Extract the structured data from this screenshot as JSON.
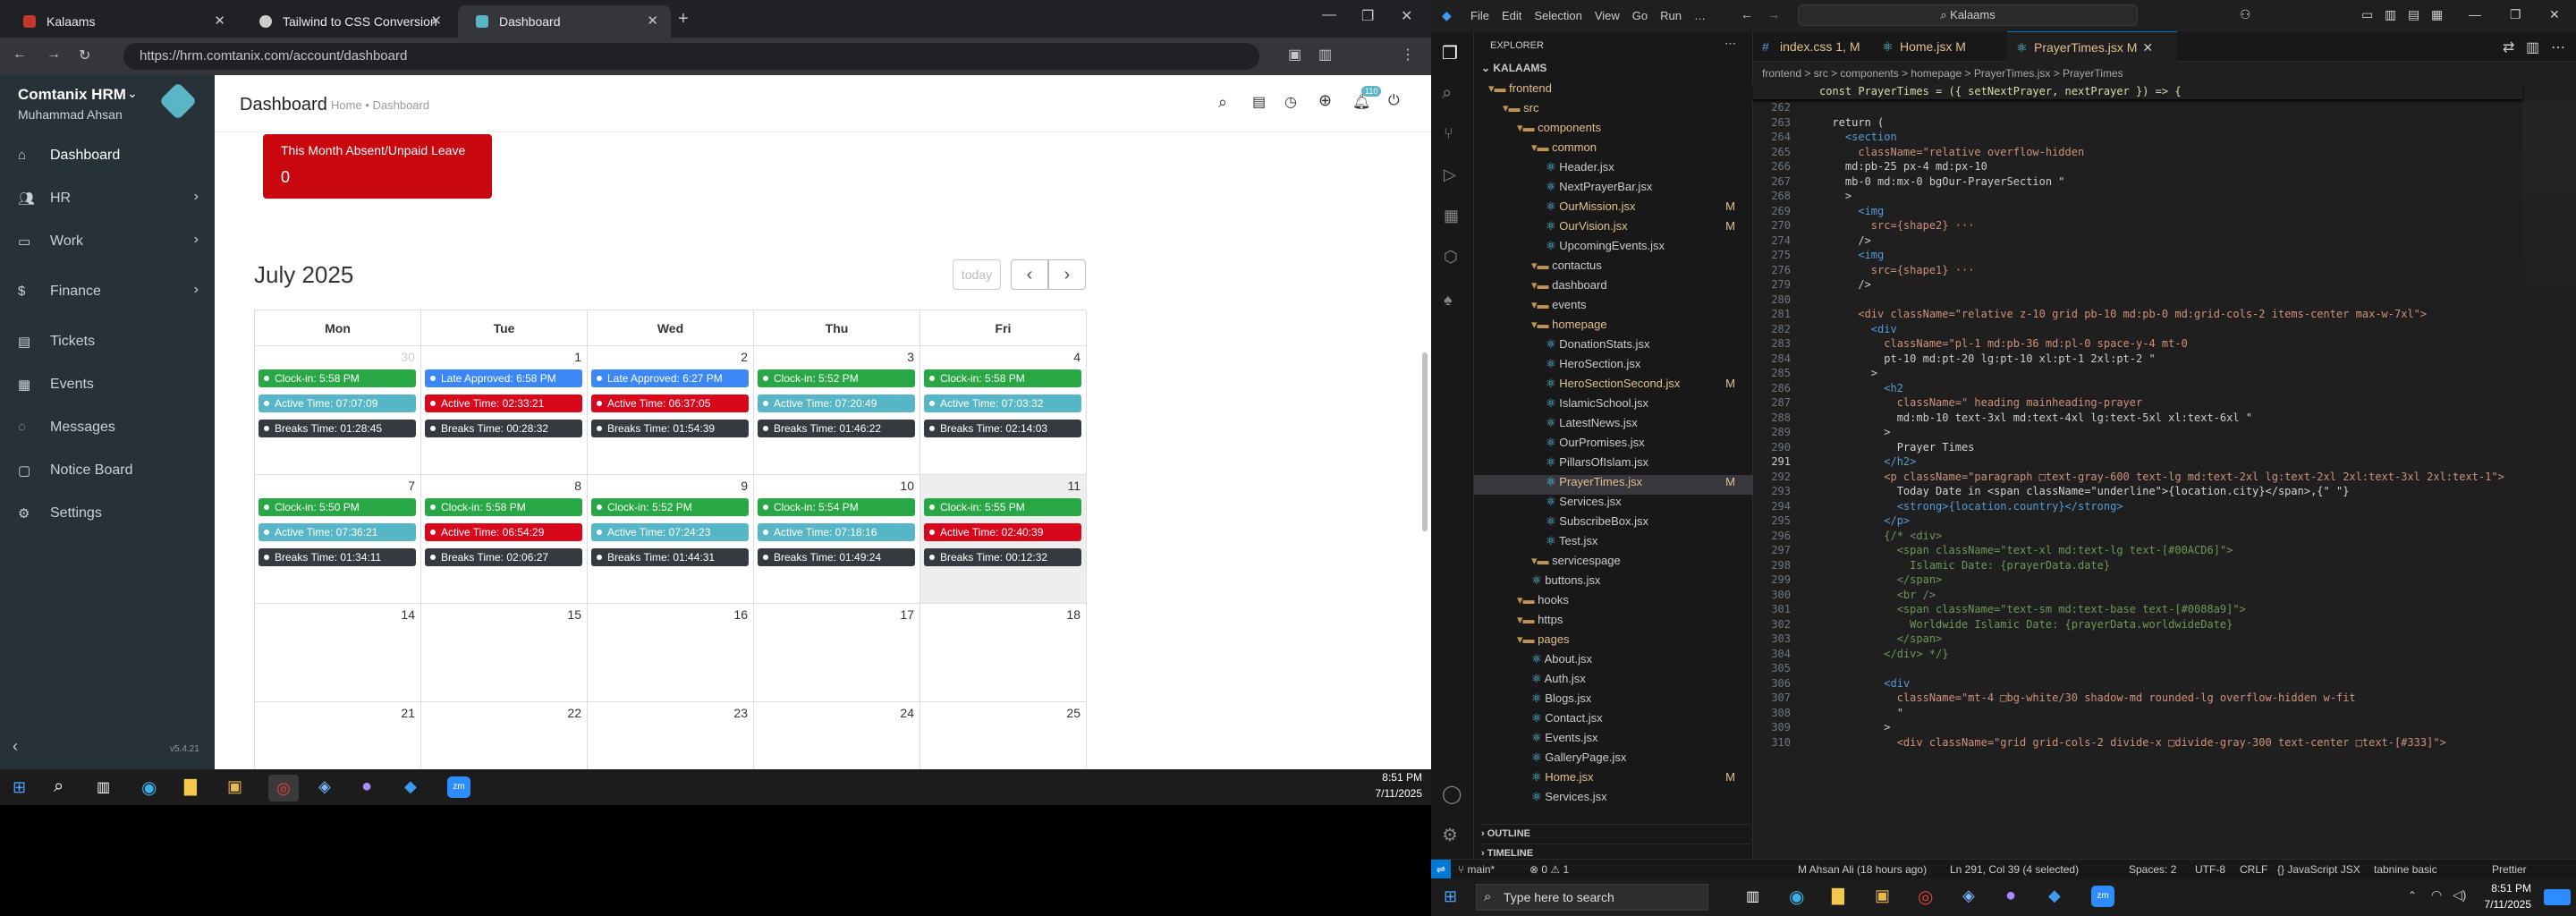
{
  "browser": {
    "tabs": [
      {
        "label": "Kalaams"
      },
      {
        "label": "Tailwind to CSS Conversion"
      },
      {
        "label": "Dashboard"
      }
    ],
    "url": "https://hrm.comtanix.com/account/dashboard",
    "profile_initial": "e"
  },
  "app": {
    "brand": "Comtanix HRM",
    "user": "Muhammad Ahsan",
    "version": "v5.4.21",
    "page_title": "Dashboard",
    "breadcrumb_home": "Home",
    "breadcrumb_sep": "•",
    "breadcrumb_current": "Dashboard",
    "notif_count": "110",
    "sidebar": [
      {
        "label": "Dashboard"
      },
      {
        "label": "HR"
      },
      {
        "label": "Work"
      },
      {
        "label": "Finance"
      },
      {
        "label": "Tickets"
      },
      {
        "label": "Events"
      },
      {
        "label": "Messages"
      },
      {
        "label": "Notice Board"
      },
      {
        "label": "Settings"
      }
    ],
    "absent_card": {
      "title": "This Month Absent/Unpaid Leave",
      "value": "0"
    },
    "calendar": {
      "month": "July 2025",
      "today_label": "today",
      "days": [
        "Mon",
        "Tue",
        "Wed",
        "Thu",
        "Fri"
      ],
      "weeks": [
        {
          "dates": [
            "30",
            "1",
            "2",
            "3",
            "4"
          ],
          "events": [
            [
              {
                "t": "Clock-in: 5:58 PM",
                "k": "g"
              },
              {
                "t": "Active Time: 07:07:09",
                "k": "c"
              },
              {
                "t": "Breaks Time: 01:28:45",
                "k": "d"
              }
            ],
            [
              {
                "t": "Late Approved: 6:58 PM",
                "k": "b"
              },
              {
                "t": "Active Time: 02:33:21",
                "k": "r"
              },
              {
                "t": "Breaks Time: 00:28:32",
                "k": "d"
              }
            ],
            [
              {
                "t": "Late Approved: 6:27 PM",
                "k": "b"
              },
              {
                "t": "Active Time: 06:37:05",
                "k": "r"
              },
              {
                "t": "Breaks Time: 01:54:39",
                "k": "d"
              }
            ],
            [
              {
                "t": "Clock-in: 5:52 PM",
                "k": "g"
              },
              {
                "t": "Active Time: 07:20:49",
                "k": "c"
              },
              {
                "t": "Breaks Time: 01:46:22",
                "k": "d"
              }
            ],
            [
              {
                "t": "Clock-in: 5:58 PM",
                "k": "g"
              },
              {
                "t": "Active Time: 07:03:32",
                "k": "c"
              },
              {
                "t": "Breaks Time: 02:14:03",
                "k": "d"
              }
            ]
          ]
        },
        {
          "dates": [
            "7",
            "8",
            "9",
            "10",
            "11"
          ],
          "events": [
            [
              {
                "t": "Clock-in: 5:50 PM",
                "k": "g"
              },
              {
                "t": "Active Time: 07:36:21",
                "k": "c"
              },
              {
                "t": "Breaks Time: 01:34:11",
                "k": "d"
              }
            ],
            [
              {
                "t": "Clock-in: 5:58 PM",
                "k": "g"
              },
              {
                "t": "Active Time: 06:54:29",
                "k": "r"
              },
              {
                "t": "Breaks Time: 02:06:27",
                "k": "d"
              }
            ],
            [
              {
                "t": "Clock-in: 5:52 PM",
                "k": "g"
              },
              {
                "t": "Active Time: 07:24:23",
                "k": "c"
              },
              {
                "t": "Breaks Time: 01:44:31",
                "k": "d"
              }
            ],
            [
              {
                "t": "Clock-in: 5:54 PM",
                "k": "g"
              },
              {
                "t": "Active Time: 07:18:16",
                "k": "c"
              },
              {
                "t": "Breaks Time: 01:49:24",
                "k": "d"
              }
            ],
            [
              {
                "t": "Clock-in: 5:55 PM",
                "k": "g"
              },
              {
                "t": "Active Time: 02:40:39",
                "k": "r"
              },
              {
                "t": "Breaks Time: 00:12:32",
                "k": "d"
              }
            ]
          ]
        },
        {
          "dates": [
            "14",
            "15",
            "16",
            "17",
            "18"
          ],
          "events": [
            [],
            [],
            [],
            [],
            []
          ]
        },
        {
          "dates": [
            "21",
            "22",
            "23",
            "24",
            "25"
          ],
          "events": [
            [],
            [],
            [],
            [],
            []
          ]
        }
      ]
    }
  },
  "taskbar_left": {
    "time": "8:51 PM",
    "date": "7/11/2025"
  },
  "vscode": {
    "title_search": "Kalaams",
    "menu": [
      "File",
      "Edit",
      "Selection",
      "View",
      "Go",
      "Run",
      "…"
    ],
    "explorer_title": "EXPLORER",
    "root": "KALAAMS",
    "tree": [
      {
        "l": "frontend",
        "d": 1,
        "f": true,
        "c": "#e2c08d"
      },
      {
        "l": "src",
        "d": 2,
        "f": true,
        "c": "#e2c08d"
      },
      {
        "l": "components",
        "d": 3,
        "f": true,
        "c": "#e2c08d"
      },
      {
        "l": "common",
        "d": 4,
        "f": true,
        "c": "#e2c08d"
      },
      {
        "l": "Header.jsx",
        "d": 5
      },
      {
        "l": "NextPrayerBar.jsx",
        "d": 5
      },
      {
        "l": "OurMission.jsx",
        "d": 5,
        "m": "M",
        "c": "#e2c08d"
      },
      {
        "l": "OurVision.jsx",
        "d": 5,
        "m": "M",
        "c": "#e2c08d"
      },
      {
        "l": "UpcomingEvents.jsx",
        "d": 5
      },
      {
        "l": "contactus",
        "d": 4,
        "f": true
      },
      {
        "l": "dashboard",
        "d": 4,
        "f": true
      },
      {
        "l": "events",
        "d": 4,
        "f": true
      },
      {
        "l": "homepage",
        "d": 4,
        "f": true,
        "c": "#e2c08d"
      },
      {
        "l": "DonationStats.jsx",
        "d": 5
      },
      {
        "l": "HeroSection.jsx",
        "d": 5
      },
      {
        "l": "HeroSectionSecond.jsx",
        "d": 5,
        "m": "M",
        "c": "#e2c08d"
      },
      {
        "l": "IslamicSchool.jsx",
        "d": 5
      },
      {
        "l": "LatestNews.jsx",
        "d": 5
      },
      {
        "l": "OurPromises.jsx",
        "d": 5
      },
      {
        "l": "PillarsOfIslam.jsx",
        "d": 5
      },
      {
        "l": "PrayerTimes.jsx",
        "d": 5,
        "m": "M",
        "c": "#e2c08d",
        "sel": true
      },
      {
        "l": "Services.jsx",
        "d": 5
      },
      {
        "l": "SubscribeBox.jsx",
        "d": 5
      },
      {
        "l": "Test.jsx",
        "d": 5
      },
      {
        "l": "servicespage",
        "d": 4,
        "f": true
      },
      {
        "l": "buttons.jsx",
        "d": 4
      },
      {
        "l": "hooks",
        "d": 3,
        "f": true
      },
      {
        "l": "https",
        "d": 3,
        "f": true
      },
      {
        "l": "pages",
        "d": 3,
        "f": true,
        "c": "#e2c08d"
      },
      {
        "l": "About.jsx",
        "d": 4
      },
      {
        "l": "Auth.jsx",
        "d": 4
      },
      {
        "l": "Blogs.jsx",
        "d": 4
      },
      {
        "l": "Contact.jsx",
        "d": 4
      },
      {
        "l": "Events.jsx",
        "d": 4
      },
      {
        "l": "GalleryPage.jsx",
        "d": 4
      },
      {
        "l": "Home.jsx",
        "d": 4,
        "m": "M",
        "c": "#e2c08d"
      },
      {
        "l": "Services.jsx",
        "d": 4
      }
    ],
    "outline": "OUTLINE",
    "timeline": "TIMELINE",
    "tabs": [
      {
        "label": "index.css 1, M"
      },
      {
        "label": "Home.jsx M"
      },
      {
        "label": "PrayerTimes.jsx M"
      }
    ],
    "breadcrumb": "frontend > src > components > homepage > PrayerTimes.jsx > PrayerTimes",
    "sticky": "const PrayerTimes = ({ setNextPrayer, nextPrayer }) => {",
    "lines": [
      [
        "262",
        ""
      ],
      [
        "263",
        "  return ("
      ],
      [
        "264",
        "    <section"
      ],
      [
        "265",
        "      className=\"relative overflow-hidden"
      ],
      [
        "266",
        "    md:pb-25 px-4 md:px-10"
      ],
      [
        "267",
        "    mb-0 md:mx-0 bgOur-PrayerSection \""
      ],
      [
        "268",
        "    >"
      ],
      [
        "269",
        "      <img"
      ],
      [
        "270",
        "        src={shape2} ···"
      ],
      [
        "274",
        "      />"
      ],
      [
        "275",
        "      <img"
      ],
      [
        "276",
        "        src={shape1} ···"
      ],
      [
        "279",
        "      />"
      ],
      [
        "280",
        ""
      ],
      [
        "281",
        "      <div className=\"relative z-10 grid pb-10 md:pb-0 md:grid-cols-2 items-center max-w-7xl\">"
      ],
      [
        "282",
        "        <div"
      ],
      [
        "283",
        "          className=\"pl-1 md:pb-36 md:pl-0 space-y-4 mt-0"
      ],
      [
        "284",
        "          pt-10 md:pt-20 lg:pt-10 xl:pt-1 2xl:pt-2 \""
      ],
      [
        "285",
        "        >"
      ],
      [
        "286",
        "          <h2"
      ],
      [
        "287",
        "            className=\" heading mainheading-prayer"
      ],
      [
        "288",
        "            md:mb-10 text-3xl md:text-4xl lg:text-5xl xl:text-6xl \""
      ],
      [
        "289",
        "          >"
      ],
      [
        "290",
        "            Prayer Times"
      ],
      [
        "291",
        "          </h2>"
      ],
      [
        "292",
        "          <p className=\"paragraph □text-gray-600 text-lg md:text-2xl lg:text-2xl 2xl:text-3xl 2xl:text-1\">"
      ],
      [
        "293",
        "            Today Date in <span className=\"underline\">{location.city}</span>,{\" \"}"
      ],
      [
        "294",
        "            <strong>{location.country}</strong>"
      ],
      [
        "295",
        "          </p>"
      ],
      [
        "296",
        "          {/* <div>"
      ],
      [
        "297",
        "            <span className=\"text-xl md:text-lg text-[#00ACD6]\">"
      ],
      [
        "298",
        "              Islamic Date: {prayerData.date}"
      ],
      [
        "299",
        "            </span>"
      ],
      [
        "300",
        "            <br />"
      ],
      [
        "301",
        "            <span className=\"text-sm md:text-base text-[#0088a9]\">"
      ],
      [
        "302",
        "              Worldwide Islamic Date: {prayerData.worldwideDate}"
      ],
      [
        "303",
        "            </span>"
      ],
      [
        "304",
        "          </div> */}"
      ],
      [
        "305",
        ""
      ],
      [
        "306",
        "          <div"
      ],
      [
        "307",
        "            className=\"mt-4 □bg-white/30 shadow-md rounded-lg overflow-hidden w-fit"
      ],
      [
        "308",
        "            \""
      ],
      [
        "309",
        "          >"
      ],
      [
        "310",
        "            <div className=\"grid grid-cols-2 divide-x □divide-gray-300 text-center □text-[#333]\">"
      ]
    ],
    "status": {
      "branch": "main*",
      "problems": "⊗ 0 ⚠ 1",
      "blame": "M Ahsan Ali (18 hours ago)",
      "cursor": "Ln 291, Col 39 (4 selected)",
      "spaces": "Spaces: 2",
      "enc": "UTF-8",
      "eol": "CRLF",
      "lang": "{} JavaScript JSX",
      "tabnine": "tabnine basic",
      "prettier": "Prettier"
    },
    "search_placeholder": "Type here to search",
    "time": "8:51 PM",
    "date": "7/11/2025"
  }
}
